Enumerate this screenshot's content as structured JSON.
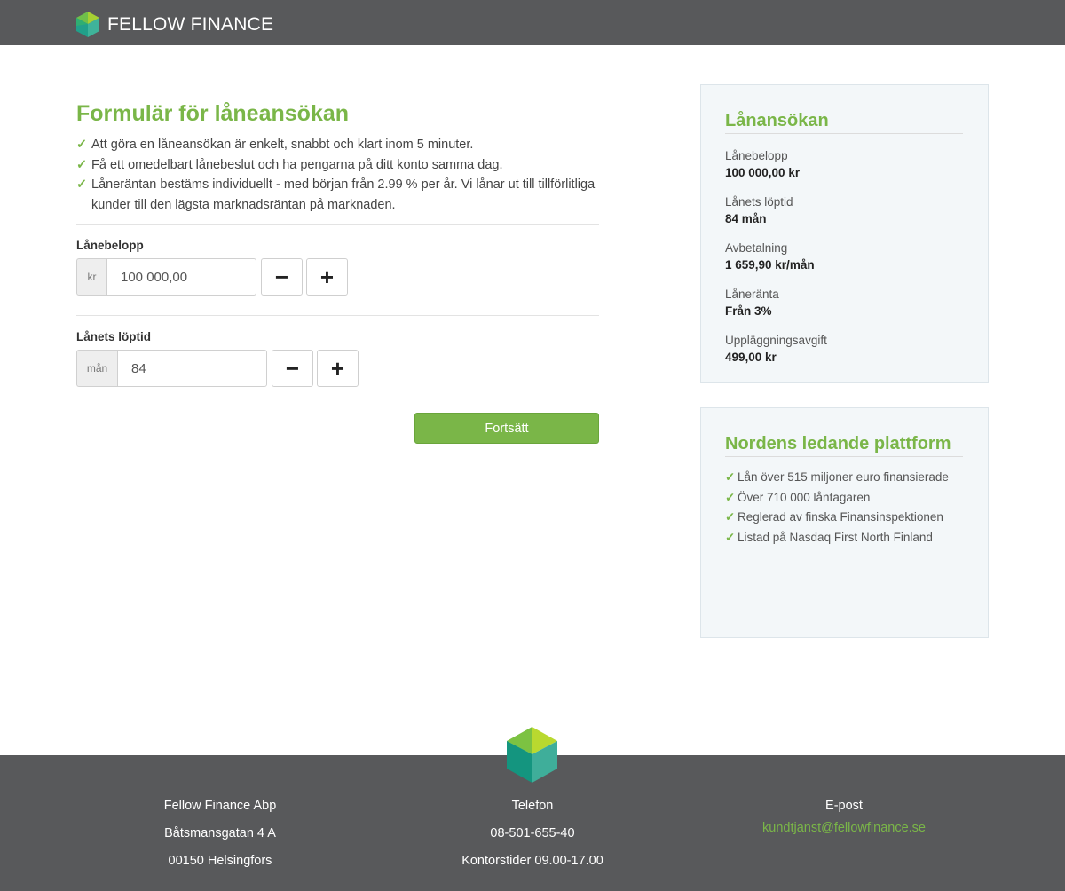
{
  "header": {
    "brand": "FELLOW FINANCE"
  },
  "form": {
    "title": "Formulär för låneansökan",
    "benefits": [
      "Att göra en låneansökan är enkelt, snabbt och klart inom 5 minuter.",
      "Få ett omedelbart lånebeslut och ha pengarna på ditt konto samma dag.",
      "Låneräntan bestäms individuellt - med början från 2.99 % per år. Vi lånar ut till tillförlitliga kunder till den lägsta marknadsräntan på marknaden."
    ],
    "amount": {
      "label": "Lånebelopp",
      "unit": "kr",
      "value": "100 000,00"
    },
    "term": {
      "label": "Lånets löptid",
      "unit": "mån",
      "value": "84"
    },
    "minus": "−",
    "plus": "+",
    "continue_label": "Fortsätt"
  },
  "summary": {
    "title": "Lånansökan",
    "items": [
      {
        "label": "Lånebelopp",
        "value": "100 000,00 kr"
      },
      {
        "label": "Lånets löptid",
        "value": "84 mån"
      },
      {
        "label": "Avbetalning",
        "value": "1 659,90 kr/mån"
      },
      {
        "label": "Låneränta",
        "value": "Från 3%"
      },
      {
        "label": "Uppläggningsavgift",
        "value": "499,00 kr"
      }
    ]
  },
  "platform": {
    "title": "Nordens ledande plattform",
    "items": [
      "Lån över 515 miljoner euro finansierade",
      "Över 710 000 låntagaren",
      "Reglerad av finska Finansinspektionen",
      "Listad på Nasdaq First North Finland"
    ]
  },
  "footer": {
    "company": {
      "name": "Fellow Finance Abp",
      "street": "Båtsmansgatan 4 A",
      "city": "00150 Helsingfors"
    },
    "phone": {
      "label": "Telefon",
      "number": "08-501-655-40",
      "hours": "Kontorstider 09.00-17.00"
    },
    "email": {
      "label": "E-post",
      "address": "kundtjanst@fellowfinance.se"
    }
  },
  "colors": {
    "brand_green": "#7ab648",
    "header_gray": "#58595b"
  }
}
